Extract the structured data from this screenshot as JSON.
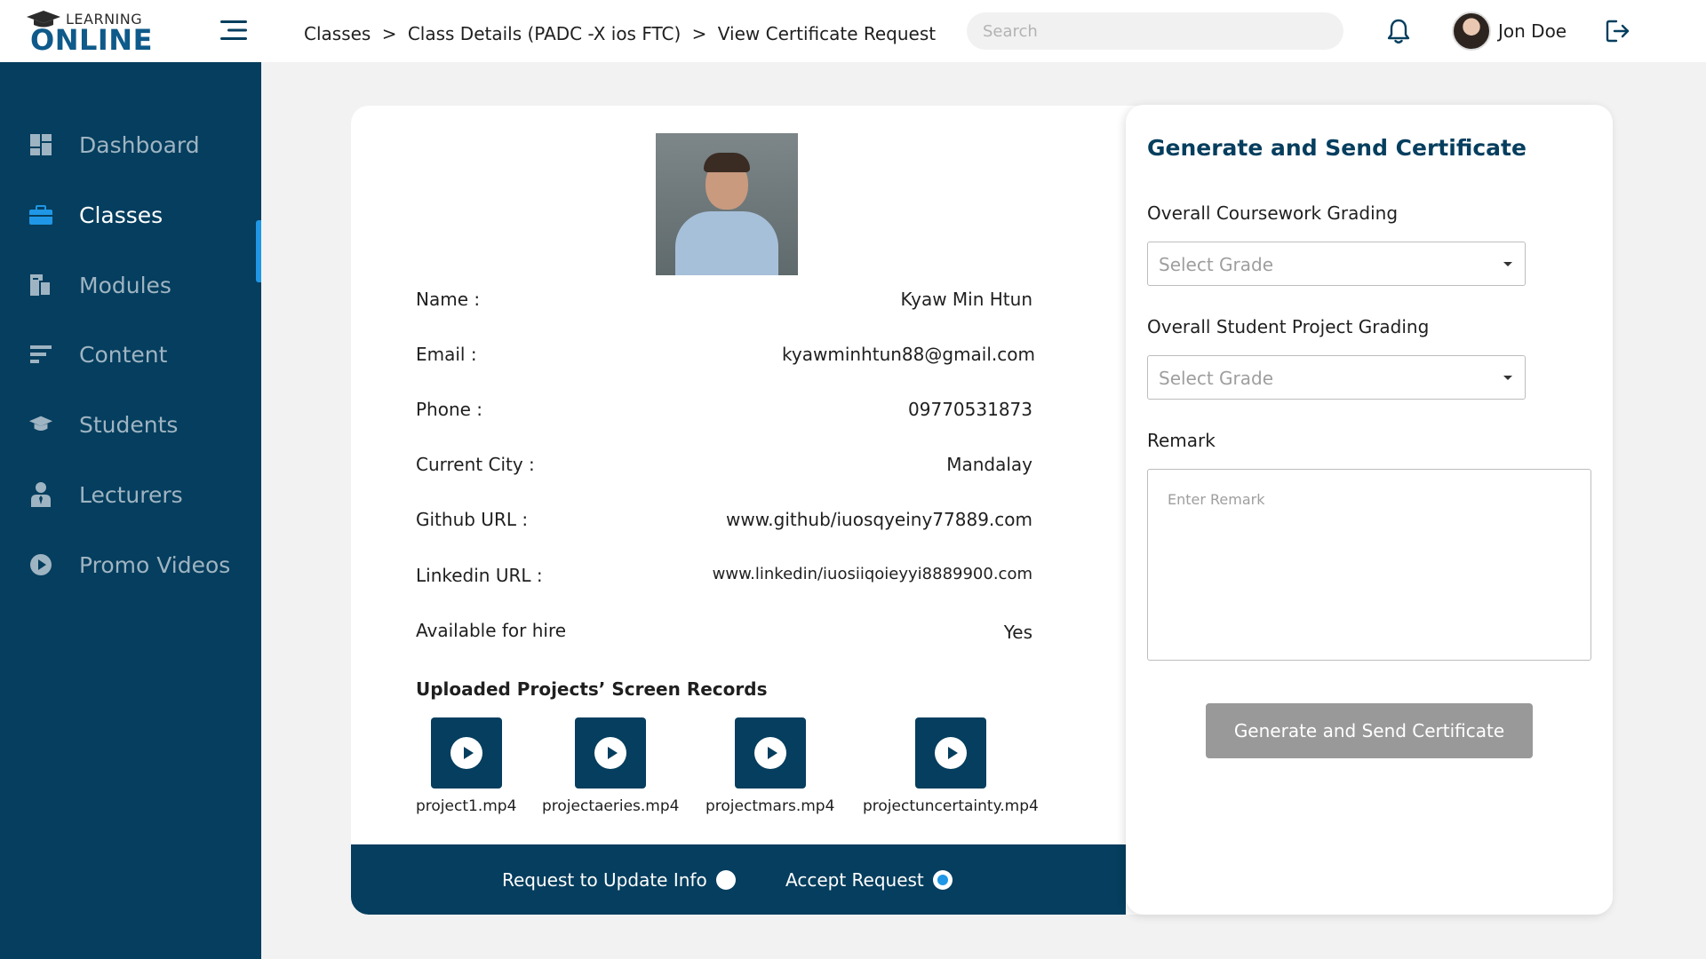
{
  "brand": {
    "top": "LEARNING",
    "bottom": "ONLINE"
  },
  "breadcrumb": [
    "Classes",
    ">",
    "Class Details (PADC -X ios FTC)",
    ">",
    "View Certificate Request"
  ],
  "search": {
    "placeholder": "Search"
  },
  "user": {
    "name": "Jon Doe"
  },
  "sidebar": {
    "items": [
      {
        "label": "Dashboard",
        "icon": "dashboard-icon"
      },
      {
        "label": "Classes",
        "icon": "briefcase-icon",
        "active": true
      },
      {
        "label": "Modules",
        "icon": "modules-icon"
      },
      {
        "label": "Content",
        "icon": "content-icon"
      },
      {
        "label": "Students",
        "icon": "graduation-cap-icon"
      },
      {
        "label": "Lecturers",
        "icon": "lecturer-icon"
      },
      {
        "label": "Promo Videos",
        "icon": "play-circle-icon"
      }
    ]
  },
  "student": {
    "fields": [
      {
        "label": "Name :",
        "value": "Kyaw Min Htun"
      },
      {
        "label": "Email :",
        "value": "kyawminhtun88@gmail.com"
      },
      {
        "label": "Phone :",
        "value": "09770531873"
      },
      {
        "label": "Current City :",
        "value": "Mandalay"
      },
      {
        "label": "Github URL :",
        "value": "www.github/iuosqyeiny77889.com"
      },
      {
        "label": "Linkedin URL :",
        "value": "www.linkedin/iuosiiqoieyyi8889900.com"
      },
      {
        "label": "Available for hire",
        "value": "Yes"
      }
    ]
  },
  "uploads": {
    "title": "Uploaded Projects’ Screen Records",
    "files": [
      "project1.mp4",
      "projectaeries.mp4",
      "projectmars.mp4",
      "projectuncertainty.mp4"
    ]
  },
  "actions": {
    "request_update": "Request to Update Info",
    "accept": "Accept Request",
    "selected": "accept"
  },
  "certificate": {
    "title": "Generate and Send Certificate",
    "coursework_label": "Overall Coursework Grading",
    "coursework_placeholder": "Select Grade",
    "project_label": "Overall Student Project Grading",
    "project_placeholder": "Select Grade",
    "remark_label": "Remark",
    "remark_placeholder": "Enter Remark",
    "button": "Generate and Send Certificate"
  },
  "colors": {
    "primary": "#053e5e",
    "accent": "#1f97e6",
    "disabled_button": "#999999"
  }
}
